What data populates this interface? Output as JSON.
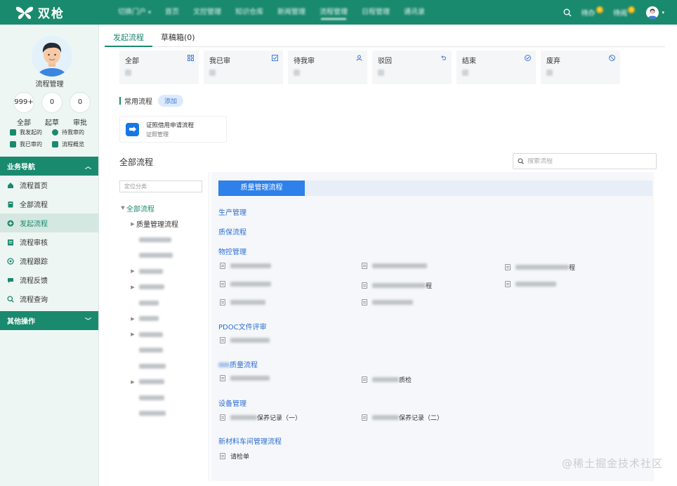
{
  "app": {
    "name": "双枪"
  },
  "nav": {
    "items": [
      {
        "label": "切换门户"
      },
      {
        "label": "首页"
      },
      {
        "label": "文控管理"
      },
      {
        "label": "知识仓库"
      },
      {
        "label": "新闻管理"
      },
      {
        "label": "流程管理"
      },
      {
        "label": "日程管理"
      },
      {
        "label": "通讯录"
      }
    ],
    "active": "流程管理"
  },
  "topright": {
    "todo_label": "待办",
    "todo_count": "0",
    "toread_label": "待阅",
    "toread_count": "0"
  },
  "sidebar": {
    "profile_name": "流程管理",
    "stats": [
      {
        "value": "999+",
        "label": "全部"
      },
      {
        "value": "0",
        "label": "起草"
      },
      {
        "value": "0",
        "label": "审批"
      }
    ],
    "quick_links": [
      "我发起的",
      "待我审的",
      "我已审的",
      "流程概览"
    ],
    "section_nav": "业务导航",
    "menu": [
      "流程首页",
      "全部流程",
      "发起流程",
      "流程审核",
      "流程跟踪",
      "流程反馈",
      "流程查询"
    ],
    "active_menu": "发起流程",
    "section_other": "其他操作"
  },
  "tabs": [
    "发起流程",
    "草稿箱(0)"
  ],
  "status_cards": [
    "全部",
    "我已审",
    "待我审",
    "驳回",
    "结束",
    "废弃"
  ],
  "common": {
    "title": "常用流程",
    "add_label": "添加",
    "process_name": "证照借用申请流程",
    "process_category": "证照管理"
  },
  "all": {
    "title": "全部流程",
    "search_placeholder": "搜索流程",
    "tree_search_placeholder": "定位分类",
    "tree_root": "全部流程",
    "tree_first": "质量管理流程",
    "active_category": "质量管理流程"
  },
  "groups": [
    {
      "title": "生产管理"
    },
    {
      "title": "质保流程"
    },
    {
      "title": "物控管理"
    },
    {
      "title": "PDOC文件评审"
    },
    {
      "title": "质量流程"
    },
    {
      "title": "设备管理"
    },
    {
      "title": "新材料车间管理流程"
    }
  ],
  "items": {
    "wk_3_suffix": "程",
    "wk_5_suffix": "程",
    "quality_2_suffix": "质检",
    "device_1_suffix": "保养记录（一）",
    "device_2_suffix": "保养记录（二）",
    "newmat_1": "请检单"
  },
  "footer_watermark": "@稀土掘金技术社区",
  "colors": {
    "brand": "#1a8a6e",
    "link_blue": "#2e6fd3",
    "active_tab_blue": "#2e80ea"
  }
}
